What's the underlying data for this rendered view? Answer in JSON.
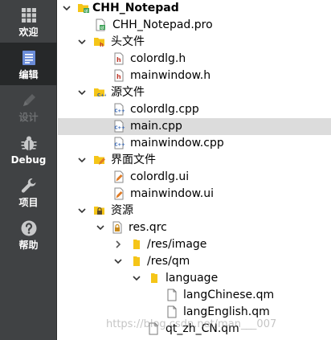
{
  "modebar": {
    "items": [
      {
        "label": "欢迎",
        "icon": "grid-icon",
        "active": false,
        "disabled": false
      },
      {
        "label": "编辑",
        "icon": "document-edit-icon",
        "active": true,
        "disabled": false
      },
      {
        "label": "设计",
        "icon": "pencil-icon",
        "active": false,
        "disabled": true
      },
      {
        "label": "Debug",
        "icon": "bug-icon",
        "active": false,
        "disabled": false
      },
      {
        "label": "项目",
        "icon": "wrench-icon",
        "active": false,
        "disabled": false
      },
      {
        "label": "帮助",
        "icon": "help-icon",
        "active": false,
        "disabled": false
      }
    ]
  },
  "tree": {
    "rows": [
      {
        "label": "CHH_Notepad",
        "icon": "project-icon",
        "arrow": "down",
        "depth": 0,
        "bold": true
      },
      {
        "label": "CHH_Notepad.pro",
        "icon": "pro-file-icon",
        "arrow": "none",
        "depth": 1
      },
      {
        "label": "头文件",
        "icon": "header-folder-icon",
        "arrow": "down",
        "depth": 1
      },
      {
        "label": "colordlg.h",
        "icon": "header-file-icon",
        "arrow": "none",
        "depth": 2
      },
      {
        "label": "mainwindow.h",
        "icon": "header-file-icon",
        "arrow": "none",
        "depth": 2
      },
      {
        "label": "源文件",
        "icon": "source-folder-icon",
        "arrow": "down",
        "depth": 1
      },
      {
        "label": "colordlg.cpp",
        "icon": "cpp-file-icon",
        "arrow": "none",
        "depth": 2
      },
      {
        "label": "main.cpp",
        "icon": "cpp-file-icon",
        "arrow": "none",
        "depth": 2,
        "selected": true
      },
      {
        "label": "mainwindow.cpp",
        "icon": "cpp-file-icon",
        "arrow": "none",
        "depth": 2
      },
      {
        "label": "界面文件",
        "icon": "form-folder-icon",
        "arrow": "down",
        "depth": 1
      },
      {
        "label": "colordlg.ui",
        "icon": "ui-file-icon",
        "arrow": "none",
        "depth": 2
      },
      {
        "label": "mainwindow.ui",
        "icon": "ui-file-icon",
        "arrow": "none",
        "depth": 2
      },
      {
        "label": "资源",
        "icon": "resource-folder-icon",
        "arrow": "down",
        "depth": 1
      },
      {
        "label": "res.qrc",
        "icon": "qrc-file-icon",
        "arrow": "down",
        "depth": 2
      },
      {
        "label": "/res/image",
        "icon": "folder-icon",
        "arrow": "right",
        "depth": 3
      },
      {
        "label": "/res/qm",
        "icon": "folder-icon",
        "arrow": "down",
        "depth": 3
      },
      {
        "label": "language",
        "icon": "folder-icon",
        "arrow": "down",
        "depth": 4
      },
      {
        "label": "langChinese.qm",
        "icon": "file-icon",
        "arrow": "none",
        "depth": 5
      },
      {
        "label": "langEnglish.qm",
        "icon": "file-icon",
        "arrow": "none",
        "depth": 5
      },
      {
        "label": "qt_zh_CN.qm",
        "icon": "file-icon",
        "arrow": "none",
        "depth": 4
      }
    ]
  },
  "watermark": "https://blog.csdn.net/man___007"
}
